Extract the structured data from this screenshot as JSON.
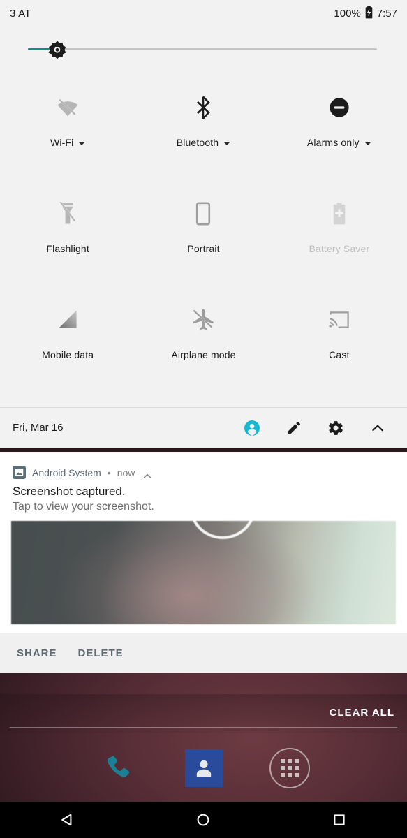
{
  "status_bar": {
    "carrier": "3 AT",
    "battery_percent": "100%",
    "battery_icon": "battery-charging-icon",
    "clock": "7:57"
  },
  "quick_settings": {
    "brightness": {
      "name": "brightness-slider",
      "icon": "brightness-icon",
      "value_percent": 8,
      "fill_color": "#009688",
      "track_color": "#c4c4c4"
    },
    "tiles": [
      {
        "label": "Wi-Fi",
        "icon": "wifi-off-icon",
        "state": "off",
        "has_caret": true,
        "dimmed": false
      },
      {
        "label": "Bluetooth",
        "icon": "bluetooth-icon",
        "state": "on",
        "has_caret": true,
        "dimmed": false
      },
      {
        "label": "Alarms only",
        "icon": "do-not-disturb-icon",
        "state": "on",
        "has_caret": true,
        "dimmed": false
      },
      {
        "label": "Flashlight",
        "icon": "flashlight-off-icon",
        "state": "off",
        "has_caret": false,
        "dimmed": false
      },
      {
        "label": "Portrait",
        "icon": "screen-rotation-portrait-icon",
        "state": "on",
        "has_caret": false,
        "dimmed": false
      },
      {
        "label": "Battery Saver",
        "icon": "battery-saver-icon",
        "state": "disabled",
        "has_caret": false,
        "dimmed": true
      },
      {
        "label": "Mobile data",
        "icon": "signal-cellular-icon",
        "state": "on",
        "has_caret": false,
        "dimmed": false
      },
      {
        "label": "Airplane mode",
        "icon": "airplane-off-icon",
        "state": "off",
        "has_caret": false,
        "dimmed": false
      },
      {
        "label": "Cast",
        "icon": "cast-icon",
        "state": "off",
        "has_caret": false,
        "dimmed": false
      }
    ],
    "footer": {
      "date": "Fri, Mar 16",
      "actions": [
        {
          "name": "user-account-icon",
          "icon": "account-circle-icon",
          "color": "#16b9d4"
        },
        {
          "name": "edit-tiles-icon",
          "icon": "pencil-icon",
          "color": "#1d1d1d"
        },
        {
          "name": "settings-icon",
          "icon": "gear-icon",
          "color": "#1d1d1d"
        },
        {
          "name": "collapse-icon",
          "icon": "chevron-up-icon",
          "color": "#1d1d1d"
        }
      ]
    }
  },
  "notification": {
    "app_icon": "image-photo-icon",
    "app_name": "Android System",
    "separator": "•",
    "time": "now",
    "expand_icon": "chevron-up-icon",
    "title": "Screenshot captured.",
    "body": "Tap to view your screenshot.",
    "thumbnail_name": "screenshot-preview-image",
    "actions": [
      {
        "label": "SHARE",
        "name": "share-button"
      },
      {
        "label": "DELETE",
        "name": "delete-button"
      }
    ]
  },
  "shade": {
    "clear_all_label": "CLEAR ALL"
  },
  "dock": {
    "items": [
      {
        "name": "phone-app-icon",
        "icon": "phone-icon",
        "label": "Phone"
      },
      {
        "name": "contacts-app-icon",
        "icon": "person-icon",
        "label": "Contacts"
      },
      {
        "name": "app-drawer-icon",
        "icon": "grid-dots-icon",
        "label": "Apps"
      }
    ]
  },
  "nav_bar": {
    "buttons": [
      {
        "name": "back-button",
        "icon": "triangle-back-icon"
      },
      {
        "name": "home-button",
        "icon": "circle-home-icon"
      },
      {
        "name": "recents-button",
        "icon": "square-recents-icon"
      }
    ]
  }
}
